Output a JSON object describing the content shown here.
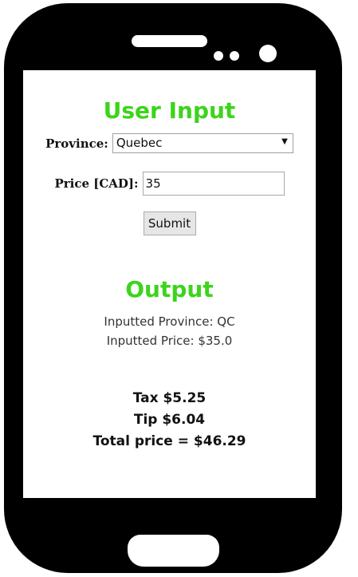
{
  "input_section": {
    "heading": "User Input",
    "province_label": "Province:",
    "province_selected": "Quebec",
    "price_label": "Price [CAD]:",
    "price_value": "35",
    "submit_label": "Submit"
  },
  "output_section": {
    "heading": "Output",
    "inputted_province": "Inputted Province: QC",
    "inputted_price": "Inputted Price: $35.0"
  },
  "summary": {
    "tax": "Tax $5.25",
    "tip": "Tip $6.04",
    "total": "Total price = $46.29"
  },
  "colors": {
    "heading": "#3cd41c",
    "phone_body": "#000000",
    "screen": "#ffffff"
  }
}
